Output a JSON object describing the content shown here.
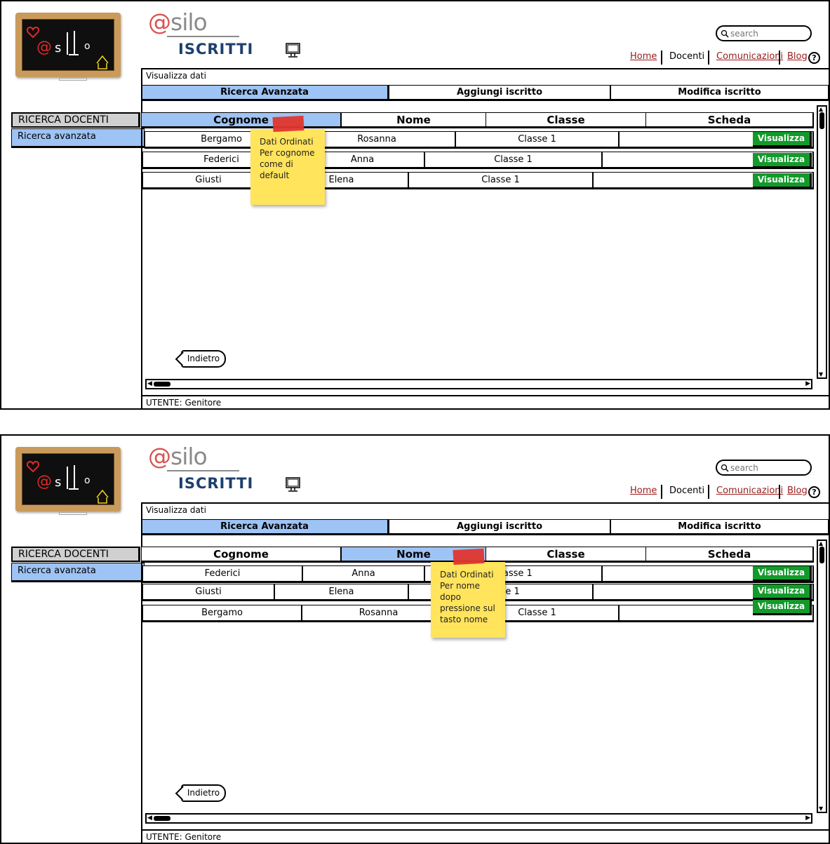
{
  "header": {
    "brand_at": "@",
    "brand_word": "silo",
    "section": "ISCRITTI",
    "logo_alt": "@sILo",
    "search_placeholder": "search",
    "nav": {
      "home": "Home",
      "docenti": "Docenti",
      "comunicazioni": "Comunicazioni",
      "blog": "Blog",
      "help": "?"
    }
  },
  "breadcrumb": "Visualizza dati",
  "tabs": [
    "Ricerca Avanzata",
    "Aggiungi iscritto",
    "Modifica iscritto"
  ],
  "active_tab": "Ricerca Avanzata",
  "sidebar": {
    "head": "RICERCA DOCENTI",
    "items": [
      "Ricerca avanzata"
    ]
  },
  "grid": {
    "headers": [
      "Cognome",
      "Nome",
      "Classe",
      "Scheda"
    ],
    "action_label": "Visualizza"
  },
  "screens": [
    {
      "sorted_by": "Cognome",
      "rows": [
        {
          "cognome": "Bergamo",
          "nome": "Rosanna",
          "classe": "Classe 1"
        },
        {
          "cognome": "Federici",
          "nome": "Anna",
          "classe": "Classe 1"
        },
        {
          "cognome": "Giusti",
          "nome": "Elena",
          "classe": "Classe 1"
        }
      ],
      "note": "Dati Ordinati Per cognome come di default",
      "note_lines": [
        "Dati Ordinati",
        "Per cognome",
        "come di",
        "default"
      ]
    },
    {
      "sorted_by": "Nome",
      "rows": [
        {
          "cognome": "Federici",
          "nome": "Anna",
          "classe": "Classe 1"
        },
        {
          "cognome": "Giusti",
          "nome": "Elena",
          "classe": "Classe 1"
        },
        {
          "cognome": "Bergamo",
          "nome": "Rosanna",
          "classe": "Classe 1"
        }
      ],
      "note": "Dati Ordinati Per nome dopo pressione sul tasto nome",
      "note_lines": [
        "Dati Ordinati",
        "Per nome",
        "dopo",
        "pressione sul",
        "tasto nome"
      ]
    }
  ],
  "back_button": "Indietro",
  "footer": "UTENTE: Genitore",
  "colors": {
    "accent_blue": "#9ec3f5",
    "action_green": "#129a2b",
    "brand_red": "#d9534f",
    "link_red": "#9a1b1b",
    "sticky_yellow": "#ffe45c"
  }
}
